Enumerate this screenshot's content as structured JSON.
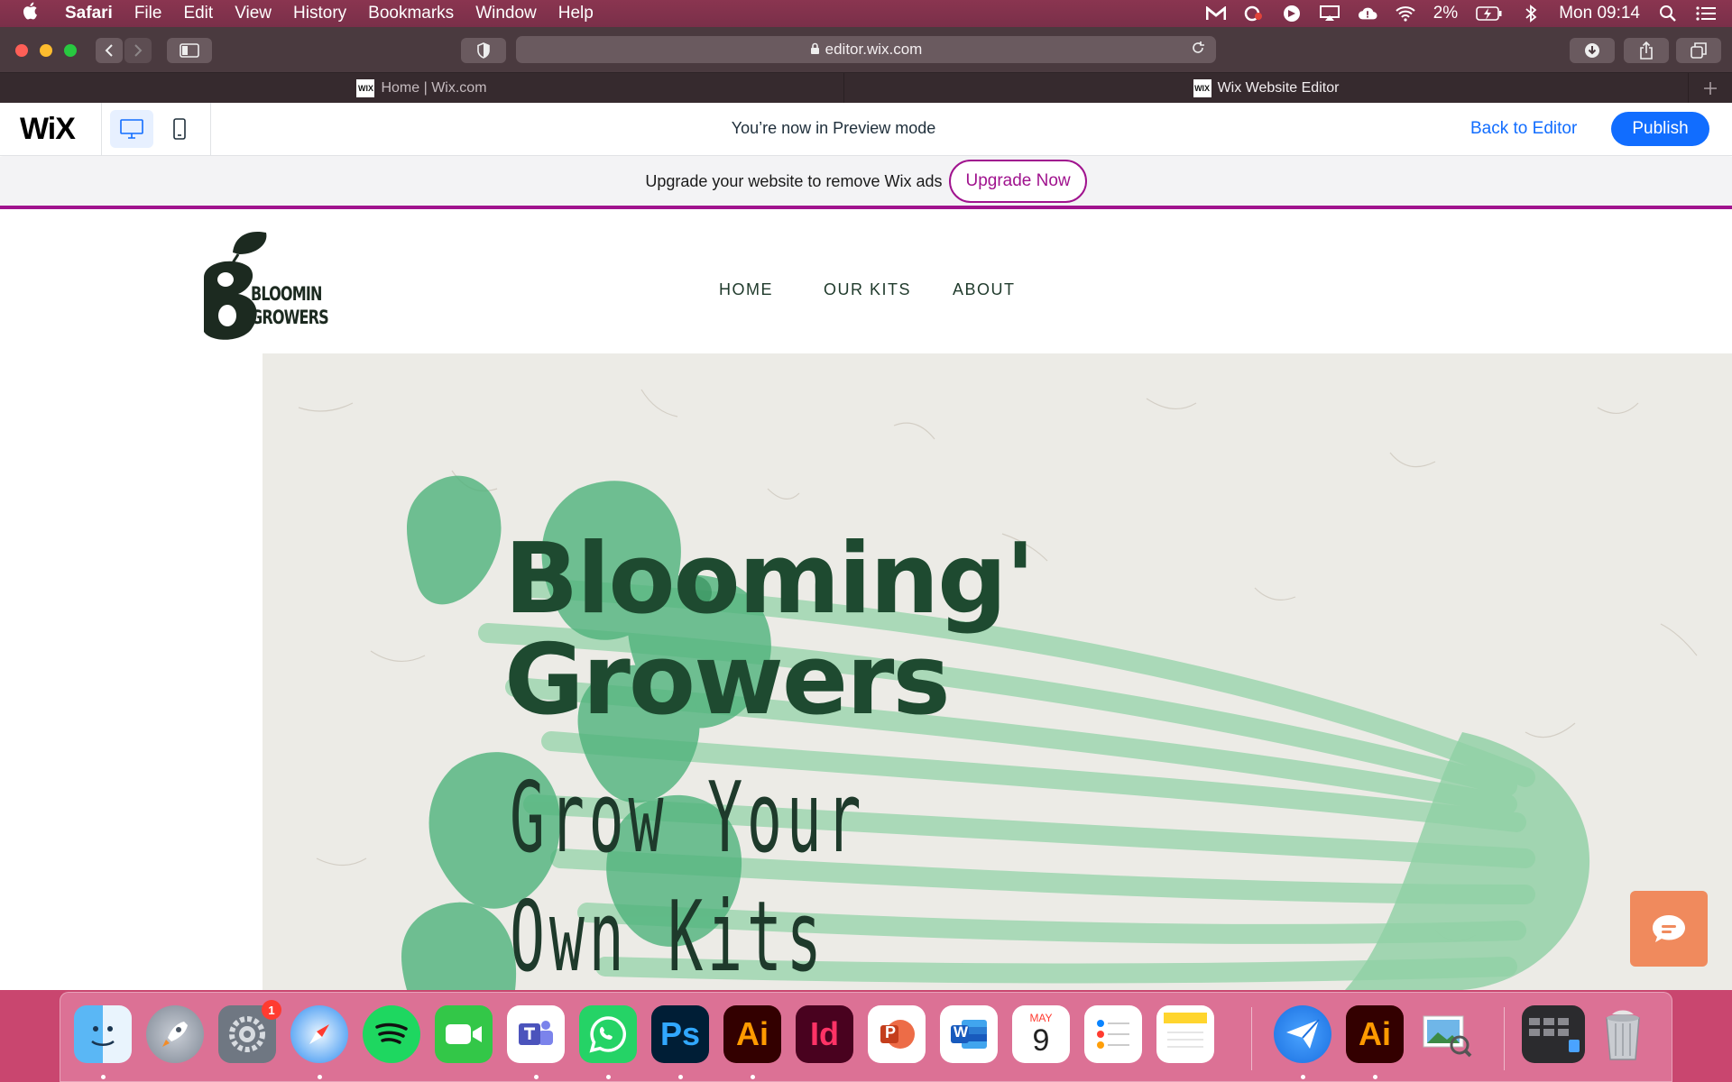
{
  "menubar": {
    "app_name": "Safari",
    "items": [
      "File",
      "Edit",
      "View",
      "History",
      "Bookmarks",
      "Window",
      "Help"
    ],
    "battery": "2%",
    "clock": "Mon 09:14"
  },
  "toolbar": {
    "url": "editor.wix.com"
  },
  "tabs": [
    {
      "title": "Home | Wix.com",
      "favicon": "WIX"
    },
    {
      "title": "Wix Website Editor",
      "favicon": "WIX"
    }
  ],
  "wix_bar": {
    "logo": "WiX",
    "preview_message": "You’re now in Preview mode",
    "back_to_editor": "Back to Editor",
    "publish": "Publish"
  },
  "ads_bar": {
    "message": "Upgrade your website to remove Wix ads",
    "upgrade_button": "Upgrade Now"
  },
  "site": {
    "logo_line1": "BLOOMIN",
    "logo_line2": "GROWERS",
    "logo_letter": "B",
    "nav": [
      "HOME",
      "OUR KITS",
      "ABOUT"
    ],
    "hero_title_line1": "Blooming'",
    "hero_title_line2": "Growers",
    "hero_sub_line1": "Grow Your",
    "hero_sub_line2": "Own Kits"
  },
  "dock": {
    "apps": [
      "Finder",
      "Launchpad",
      "System Preferences",
      "Safari",
      "Spotify",
      "FaceTime",
      "Teams",
      "WhatsApp",
      "Photoshop",
      "Illustrator",
      "InDesign",
      "PowerPoint",
      "Word",
      "Calendar",
      "Reminders",
      "Notes",
      "Spark",
      "Illustrator",
      "Preview",
      "Mission Control",
      "Trash"
    ],
    "calendar_month": "MAY",
    "calendar_day": "9",
    "system_prefs_badge": "1",
    "labels": {
      "ps": "Ps",
      "ai": "Ai",
      "id": "Id",
      "ppt": "P",
      "word": "W"
    }
  },
  "colors": {
    "wix_blue": "#116dff",
    "upgrade_purple": "#a0138e",
    "hero_green": "#1e4a30",
    "chat_orange": "#f08a5d"
  }
}
